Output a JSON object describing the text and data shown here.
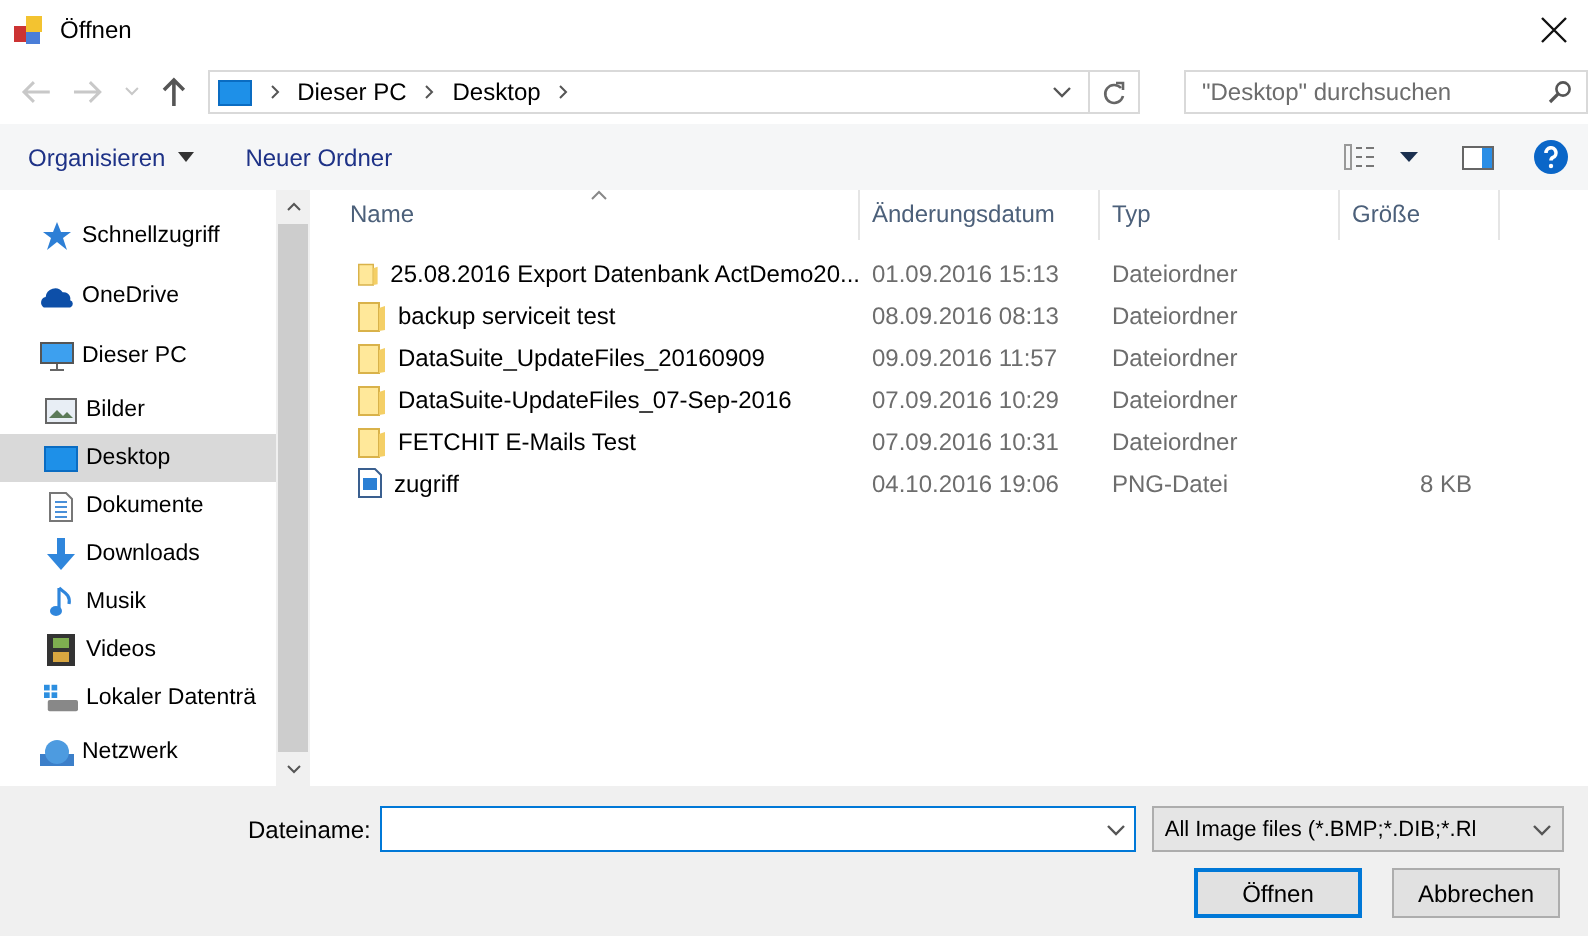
{
  "window": {
    "title": "Öffnen"
  },
  "address": {
    "crumbs": [
      "Dieser PC",
      "Desktop"
    ]
  },
  "search": {
    "placeholder": "\"Desktop\" durchsuchen"
  },
  "toolbar": {
    "organize": "Organisieren",
    "new_folder": "Neuer Ordner"
  },
  "sidebar": {
    "items": [
      {
        "label": "Schnellzugriff",
        "selected": false
      },
      {
        "label": "OneDrive",
        "selected": false
      },
      {
        "label": "Dieser PC",
        "selected": false,
        "children": [
          {
            "label": "Bilder",
            "selected": false
          },
          {
            "label": "Desktop",
            "selected": true
          },
          {
            "label": "Dokumente",
            "selected": false
          },
          {
            "label": "Downloads",
            "selected": false
          },
          {
            "label": "Musik",
            "selected": false
          },
          {
            "label": "Videos",
            "selected": false
          },
          {
            "label": "Lokaler Datenträ",
            "selected": false
          }
        ]
      },
      {
        "label": "Netzwerk",
        "selected": false
      }
    ]
  },
  "table": {
    "columns": [
      "Name",
      "Änderungsdatum",
      "Typ",
      "Größe"
    ],
    "rows": [
      {
        "kind": "folder",
        "name": "25.08.2016 Export Datenbank ActDemo20...",
        "date": "01.09.2016 15:13",
        "type": "Dateiordner",
        "size": ""
      },
      {
        "kind": "folder",
        "name": "backup serviceit test",
        "date": "08.09.2016 08:13",
        "type": "Dateiordner",
        "size": ""
      },
      {
        "kind": "folder",
        "name": "DataSuite_UpdateFiles_20160909",
        "date": "09.09.2016 11:57",
        "type": "Dateiordner",
        "size": ""
      },
      {
        "kind": "folder",
        "name": "DataSuite-UpdateFiles_07-Sep-2016",
        "date": "07.09.2016 10:29",
        "type": "Dateiordner",
        "size": ""
      },
      {
        "kind": "folder",
        "name": "FETCHIT E-Mails Test",
        "date": "07.09.2016 10:31",
        "type": "Dateiordner",
        "size": ""
      },
      {
        "kind": "image",
        "name": "zugriff",
        "date": "04.10.2016 19:06",
        "type": "PNG-Datei",
        "size": "8 KB"
      }
    ]
  },
  "footer": {
    "filename_label": "Dateiname:",
    "filter": "All Image files (*.BMP;*.DIB;*.Rl",
    "open": "Öffnen",
    "cancel": "Abbrechen"
  }
}
